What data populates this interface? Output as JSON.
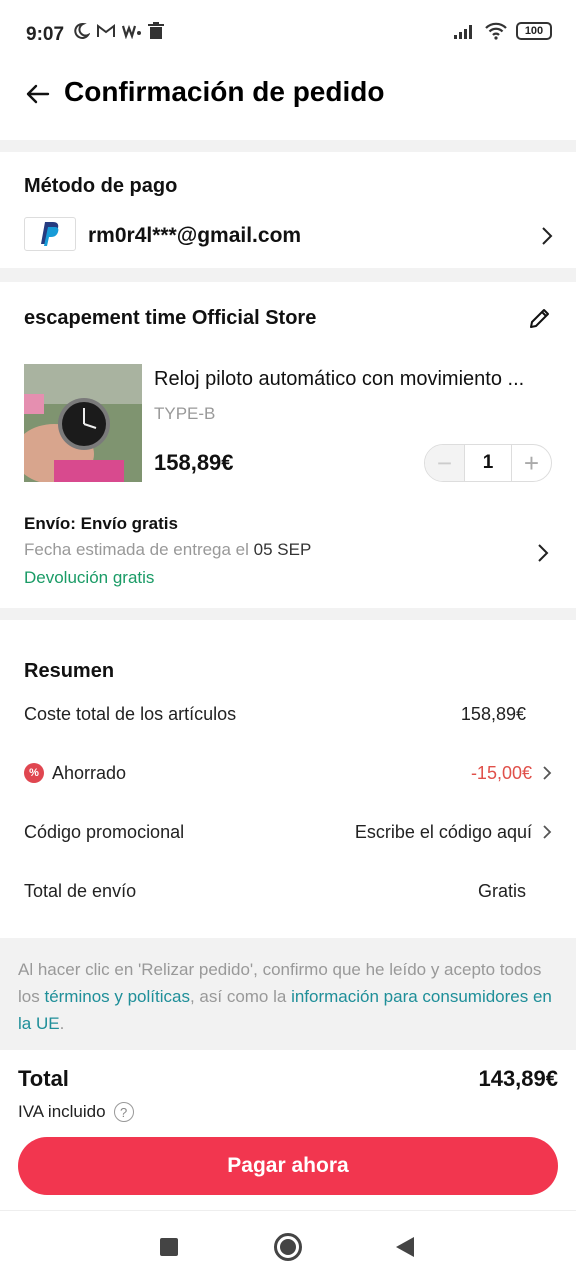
{
  "status_bar": {
    "time": "9:07",
    "left_icons": [
      "moon-icon",
      "gmail-icon",
      "w-icon",
      "trash-icon"
    ],
    "right_icons": [
      "signal-icon",
      "wifi-icon",
      "battery-icon"
    ],
    "battery": "100"
  },
  "header": {
    "title": "Confirmación de pedido"
  },
  "payment": {
    "title": "Método de pago",
    "method_icon": "paypal-icon",
    "email": "rm0r4l***@gmail.com"
  },
  "store": {
    "name": "escapement time Official Store",
    "product": {
      "name": "Reloj piloto automático con movimiento ...",
      "variant": "TYPE-B",
      "price": "158,89€",
      "quantity": "1",
      "minus": "−",
      "plus": "+"
    },
    "shipping": {
      "label": "Envío: Envío gratis",
      "date_prefix": "Fecha estimada de entrega el",
      "date": "05 SEP",
      "returns": "Devolución gratis"
    }
  },
  "summary": {
    "title": "Resumen",
    "items_total_label": "Coste total de los artículos",
    "items_total_value": "158,89€",
    "saved_label": "Ahorrado",
    "saved_badge": "%",
    "saved_value": "-15,00€",
    "promo_label": "Código promocional",
    "promo_value": "Escribe el código aquí",
    "shipping_label": "Total de envío",
    "shipping_value": "Gratis"
  },
  "legal": {
    "text_1": "Al hacer clic en 'Relizar pedido', confirmo que he leído y acepto todos los ",
    "link_1": "términos y políticas",
    "text_2": ", así como la ",
    "link_2": "información para consumidores en la UE",
    "text_3": "."
  },
  "checkout": {
    "total_label": "Total",
    "total_value": "143,89€",
    "vat_label": "IVA incluido",
    "vat_help": "?",
    "pay_button": "Pagar ahora"
  },
  "colors": {
    "accent": "#f2364f",
    "green": "#1a9b66",
    "link": "#1f8f99",
    "discount": "#e0504a"
  }
}
